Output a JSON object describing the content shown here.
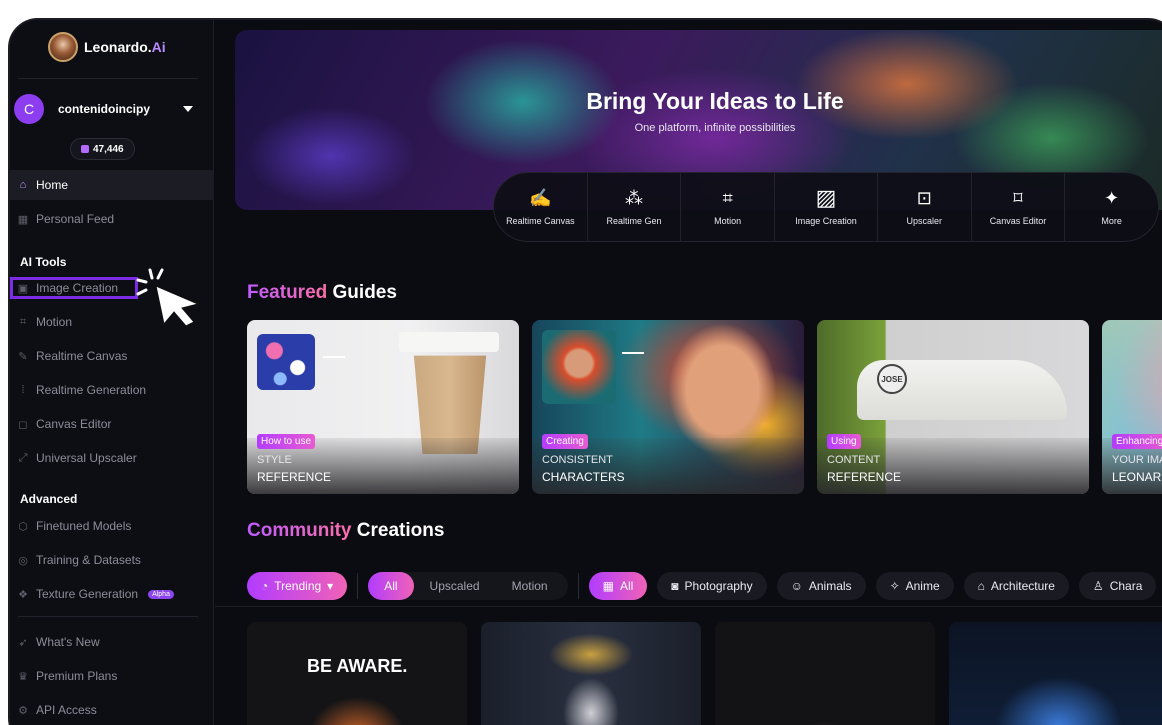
{
  "app": {
    "name": "Leonardo.",
    "name_accent": "Ai"
  },
  "user": {
    "initial": "C",
    "name": "contenidoincipy",
    "tokens": "47,446"
  },
  "sidebar": {
    "nav": [
      {
        "label": "Home",
        "icon": "home-icon",
        "active": true
      },
      {
        "label": "Personal Feed",
        "icon": "grid-icon"
      }
    ],
    "ai_tools_title": "AI Tools",
    "ai_tools": [
      {
        "label": "Image Creation",
        "icon": "image-icon"
      },
      {
        "label": "Motion",
        "icon": "film-icon"
      },
      {
        "label": "Realtime Canvas",
        "icon": "brush-icon"
      },
      {
        "label": "Realtime Generation",
        "icon": "dots-grid-icon"
      },
      {
        "label": "Canvas Editor",
        "icon": "crop-icon"
      },
      {
        "label": "Universal Upscaler",
        "icon": "upscale-icon"
      }
    ],
    "advanced_title": "Advanced",
    "advanced": [
      {
        "label": "Finetuned Models",
        "icon": "cube-icon"
      },
      {
        "label": "Training & Datasets",
        "icon": "dataset-icon"
      },
      {
        "label": "Texture Generation",
        "icon": "texture-icon",
        "badge": "Alpha"
      }
    ],
    "bottom": [
      {
        "label": "What's New",
        "icon": "rocket-icon"
      },
      {
        "label": "Premium Plans",
        "icon": "crown-icon"
      },
      {
        "label": "API Access",
        "icon": "api-icon"
      }
    ]
  },
  "hero": {
    "title": "Bring Your Ideas to Life",
    "subtitle": "One platform, infinite possibilities"
  },
  "tools": [
    {
      "label": "Realtime Canvas",
      "icon": "brush-icon"
    },
    {
      "label": "Realtime Gen",
      "icon": "dots-grid-icon"
    },
    {
      "label": "Motion",
      "icon": "film-icon"
    },
    {
      "label": "Image Creation",
      "icon": "image-icon"
    },
    {
      "label": "Upscaler",
      "icon": "upscale-icon"
    },
    {
      "label": "Canvas Editor",
      "icon": "crop-icon"
    },
    {
      "label": "More",
      "icon": "sparkle-icon"
    }
  ],
  "featured": {
    "title_accent": "Featured",
    "title_rest": " Guides",
    "cards": [
      {
        "tag": "How to use",
        "line1": "STYLE",
        "line2": "REFERENCE"
      },
      {
        "tag": "Creating",
        "line1": "CONSISTENT",
        "line2": "CHARACTERS"
      },
      {
        "tag": "Using",
        "line1": "CONTENT",
        "line2": "REFERENCE"
      },
      {
        "tag": "Enhancing",
        "line1": "YOUR IMAG",
        "line2": "LEONARD"
      }
    ],
    "sneaker_text": "JOSE"
  },
  "community": {
    "title_accent": "Community",
    "title_rest": " Creations",
    "sort": "Trending",
    "media_filters": [
      "All",
      "Upscaled",
      "Motion"
    ],
    "categories": [
      "All",
      "Photography",
      "Animals",
      "Anime",
      "Architecture",
      "Chara"
    ],
    "first_card_text": "BE AWARE."
  },
  "colors": {
    "accent_purple": "#b13cff",
    "accent_pink": "#f062b6",
    "bg": "#0b0b12",
    "highlight_box": "#7d2ce6"
  }
}
